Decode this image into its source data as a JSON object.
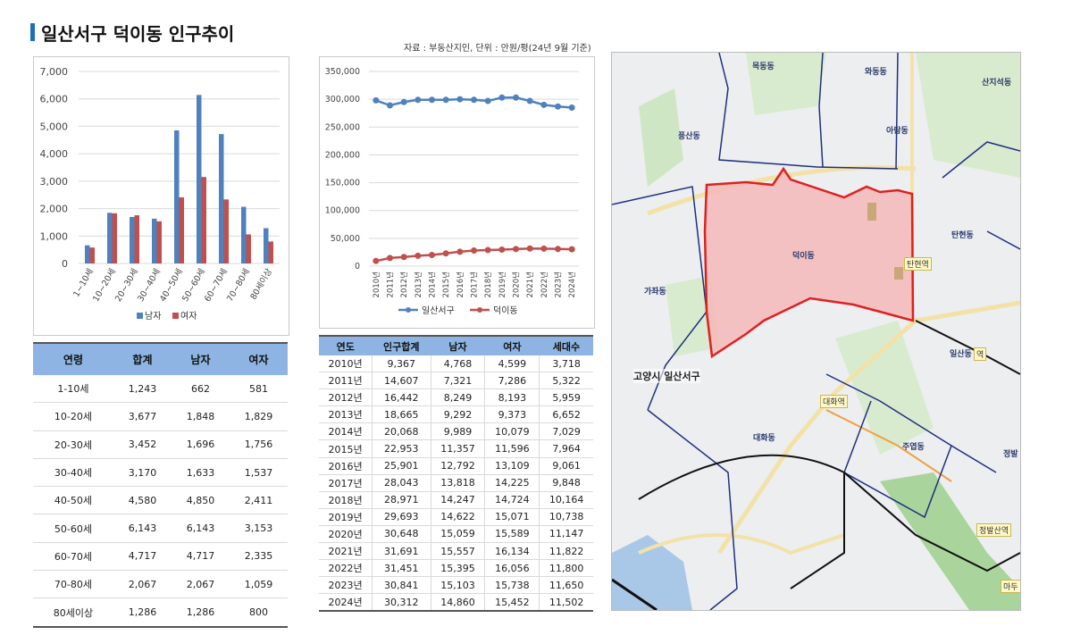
{
  "header": {
    "title": "일산서구 덕이동 인구추이",
    "source": "자료 : 부동산지인, 단위 : 만원/평(24년 9월 기준)"
  },
  "chart_data": [
    {
      "type": "bar",
      "categories": [
        "1~10세",
        "10~20세",
        "20~30세",
        "30~40세",
        "40~50세",
        "50~60세",
        "60~70세",
        "70~80세",
        "80세이상"
      ],
      "series": [
        {
          "name": "남자",
          "color": "#4f81bd",
          "values": [
            662,
            1848,
            1696,
            1633,
            4850,
            6143,
            4717,
            2067,
            1286
          ]
        },
        {
          "name": "여자",
          "color": "#c0504d",
          "values": [
            581,
            1829,
            1756,
            1537,
            2411,
            3153,
            2335,
            1059,
            800
          ]
        }
      ],
      "ylim": [
        0,
        7000
      ],
      "yticks": [
        "0",
        "1,000",
        "2,000",
        "3,000",
        "4,000",
        "5,000",
        "6,000",
        "7,000"
      ],
      "grid": true,
      "legend": "bottom"
    },
    {
      "type": "line",
      "categories": [
        "2010년",
        "2011년",
        "2012년",
        "2013년",
        "2014년",
        "2015년",
        "2016년",
        "2017년",
        "2018년",
        "2019년",
        "2020년",
        "2021년",
        "2022년",
        "2023년",
        "2024년"
      ],
      "series": [
        {
          "name": "일산서구",
          "color": "#4f81bd",
          "values": [
            298000,
            289000,
            295000,
            299000,
            299000,
            299000,
            300000,
            299000,
            297000,
            303000,
            303000,
            297000,
            290000,
            287000,
            285000
          ]
        },
        {
          "name": "덕이동",
          "color": "#c0504d",
          "values": [
            9367,
            14607,
            16442,
            18665,
            20068,
            22953,
            25901,
            28043,
            28971,
            29693,
            30648,
            31691,
            31451,
            30841,
            30312
          ]
        }
      ],
      "ylim": [
        0,
        350000
      ],
      "yticks": [
        "0",
        "50,000",
        "100,000",
        "150,000",
        "200,000",
        "250,000",
        "300,000",
        "350,000"
      ],
      "grid": true,
      "legend": "bottom"
    }
  ],
  "age_table": {
    "headers": [
      "연령",
      "합계",
      "남자",
      "여자"
    ],
    "rows": [
      [
        "1-10세",
        "1,243",
        "662",
        "581"
      ],
      [
        "10-20세",
        "3,677",
        "1,848",
        "1,829"
      ],
      [
        "20-30세",
        "3,452",
        "1,696",
        "1,756"
      ],
      [
        "30-40세",
        "3,170",
        "1,633",
        "1,537"
      ],
      [
        "40-50세",
        "4,580",
        "4,850",
        "2,411"
      ],
      [
        "50-60세",
        "6,143",
        "6,143",
        "3,153"
      ],
      [
        "60-70세",
        "4,717",
        "4,717",
        "2,335"
      ],
      [
        "70-80세",
        "2,067",
        "2,067",
        "1,059"
      ],
      [
        "80세이상",
        "1,286",
        "1,286",
        "800"
      ]
    ]
  },
  "year_table": {
    "headers": [
      "연도",
      "인구합계",
      "남자",
      "여자",
      "세대수"
    ],
    "rows": [
      [
        "2010년",
        "9,367",
        "4,768",
        "4,599",
        "3,718"
      ],
      [
        "2011년",
        "14,607",
        "7,321",
        "7,286",
        "5,322"
      ],
      [
        "2012년",
        "16,442",
        "8,249",
        "8,193",
        "5,959"
      ],
      [
        "2013년",
        "18,665",
        "9,292",
        "9,373",
        "6,652"
      ],
      [
        "2014년",
        "20,068",
        "9,989",
        "10,079",
        "7,029"
      ],
      [
        "2015년",
        "22,953",
        "11,357",
        "11,596",
        "7,964"
      ],
      [
        "2016년",
        "25,901",
        "12,792",
        "13,109",
        "9,061"
      ],
      [
        "2017년",
        "28,043",
        "13,818",
        "14,225",
        "9,848"
      ],
      [
        "2018년",
        "28,971",
        "14,247",
        "14,724",
        "10,164"
      ],
      [
        "2019년",
        "29,693",
        "14,622",
        "15,071",
        "10,738"
      ],
      [
        "2020년",
        "30,648",
        "15,059",
        "15,589",
        "11,147"
      ],
      [
        "2021년",
        "31,691",
        "15,557",
        "16,134",
        "11,822"
      ],
      [
        "2022년",
        "31,451",
        "15,395",
        "16,056",
        "11,800"
      ],
      [
        "2023년",
        "30,841",
        "15,103",
        "15,738",
        "11,650"
      ],
      [
        "2024년",
        "30,312",
        "14,860",
        "15,452",
        "11,502"
      ]
    ]
  },
  "map": {
    "labels": [
      "목동동",
      "와동동",
      "산지석동",
      "풍산동",
      "아람동",
      "덕이동",
      "탄현동",
      "가좌동",
      "고양시 일산서구",
      "일산동",
      "대화동",
      "주엽동",
      "정발"
    ],
    "stations": [
      "탄현역",
      "대화역",
      "정발산역",
      "역",
      "마두"
    ],
    "highlight_color": "#f4b8b8",
    "border_color": "#e02020"
  }
}
